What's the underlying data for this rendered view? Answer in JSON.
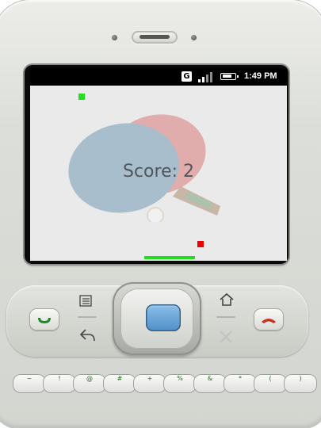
{
  "status_bar": {
    "carrier_icon_label": "G",
    "time": "1:49 PM"
  },
  "game": {
    "score_text": "Score: 2",
    "colors": {
      "ball": "#22dd22",
      "opponent": "#ee0000",
      "paddle": "#22dd22",
      "background": "#eaeaea"
    }
  },
  "keyboard": {
    "top_row_glyphs": [
      "~",
      "!",
      "@",
      "#",
      "+",
      "%",
      "&",
      "*",
      "(",
      ")"
    ]
  },
  "icons": [
    "menu-icon",
    "back-icon",
    "home-icon",
    "search-icon",
    "call-icon",
    "end-call-icon"
  ]
}
